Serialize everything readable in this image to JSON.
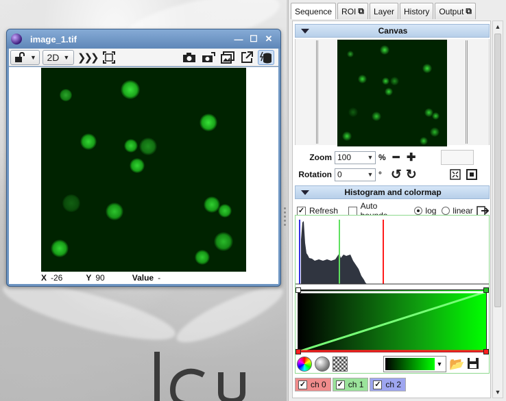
{
  "image_window": {
    "title": "image_1.tif",
    "toolbar": {
      "view_mode": "2D",
      "view_mode_options": [
        "2D"
      ]
    },
    "status": {
      "x_label": "X",
      "x_value": "-26",
      "y_label": "Y",
      "y_value": "90",
      "value_label": "Value",
      "value_value": "-"
    }
  },
  "panel": {
    "tabs": [
      {
        "label": "Sequence",
        "external": false
      },
      {
        "label": "ROI",
        "external": true
      },
      {
        "label": "Layer",
        "external": false
      },
      {
        "label": "History",
        "external": false
      },
      {
        "label": "Output",
        "external": true
      }
    ],
    "canvas_section": {
      "title": "Canvas",
      "zoom_label": "Zoom",
      "zoom_value": "100",
      "zoom_unit": "%",
      "rotation_label": "Rotation",
      "rotation_value": "0",
      "rotation_unit": "°"
    },
    "histogram_section": {
      "title": "Histogram and colormap",
      "refresh_label": "Refresh",
      "refresh_checked": true,
      "auto_bounds_label": "Auto bounds",
      "auto_bounds_checked": false,
      "scale_options": [
        "log",
        "linear"
      ],
      "scale_selected": "log"
    },
    "channels": [
      {
        "label": "ch 0",
        "checked": true,
        "color": "#f08c8c"
      },
      {
        "label": "ch 1",
        "checked": true,
        "color": "#9be39b"
      },
      {
        "label": "ch 2",
        "checked": true,
        "color": "#9ea6f0"
      }
    ]
  },
  "colors": {
    "cell_green": "#2fd12f",
    "background_dark": "#002300",
    "window_frame": "#6e95c2",
    "section_header": "#c6d9ee",
    "marker_blue": "#3030e0",
    "marker_green": "#5fe05f",
    "marker_red": "#ff1a1a"
  }
}
